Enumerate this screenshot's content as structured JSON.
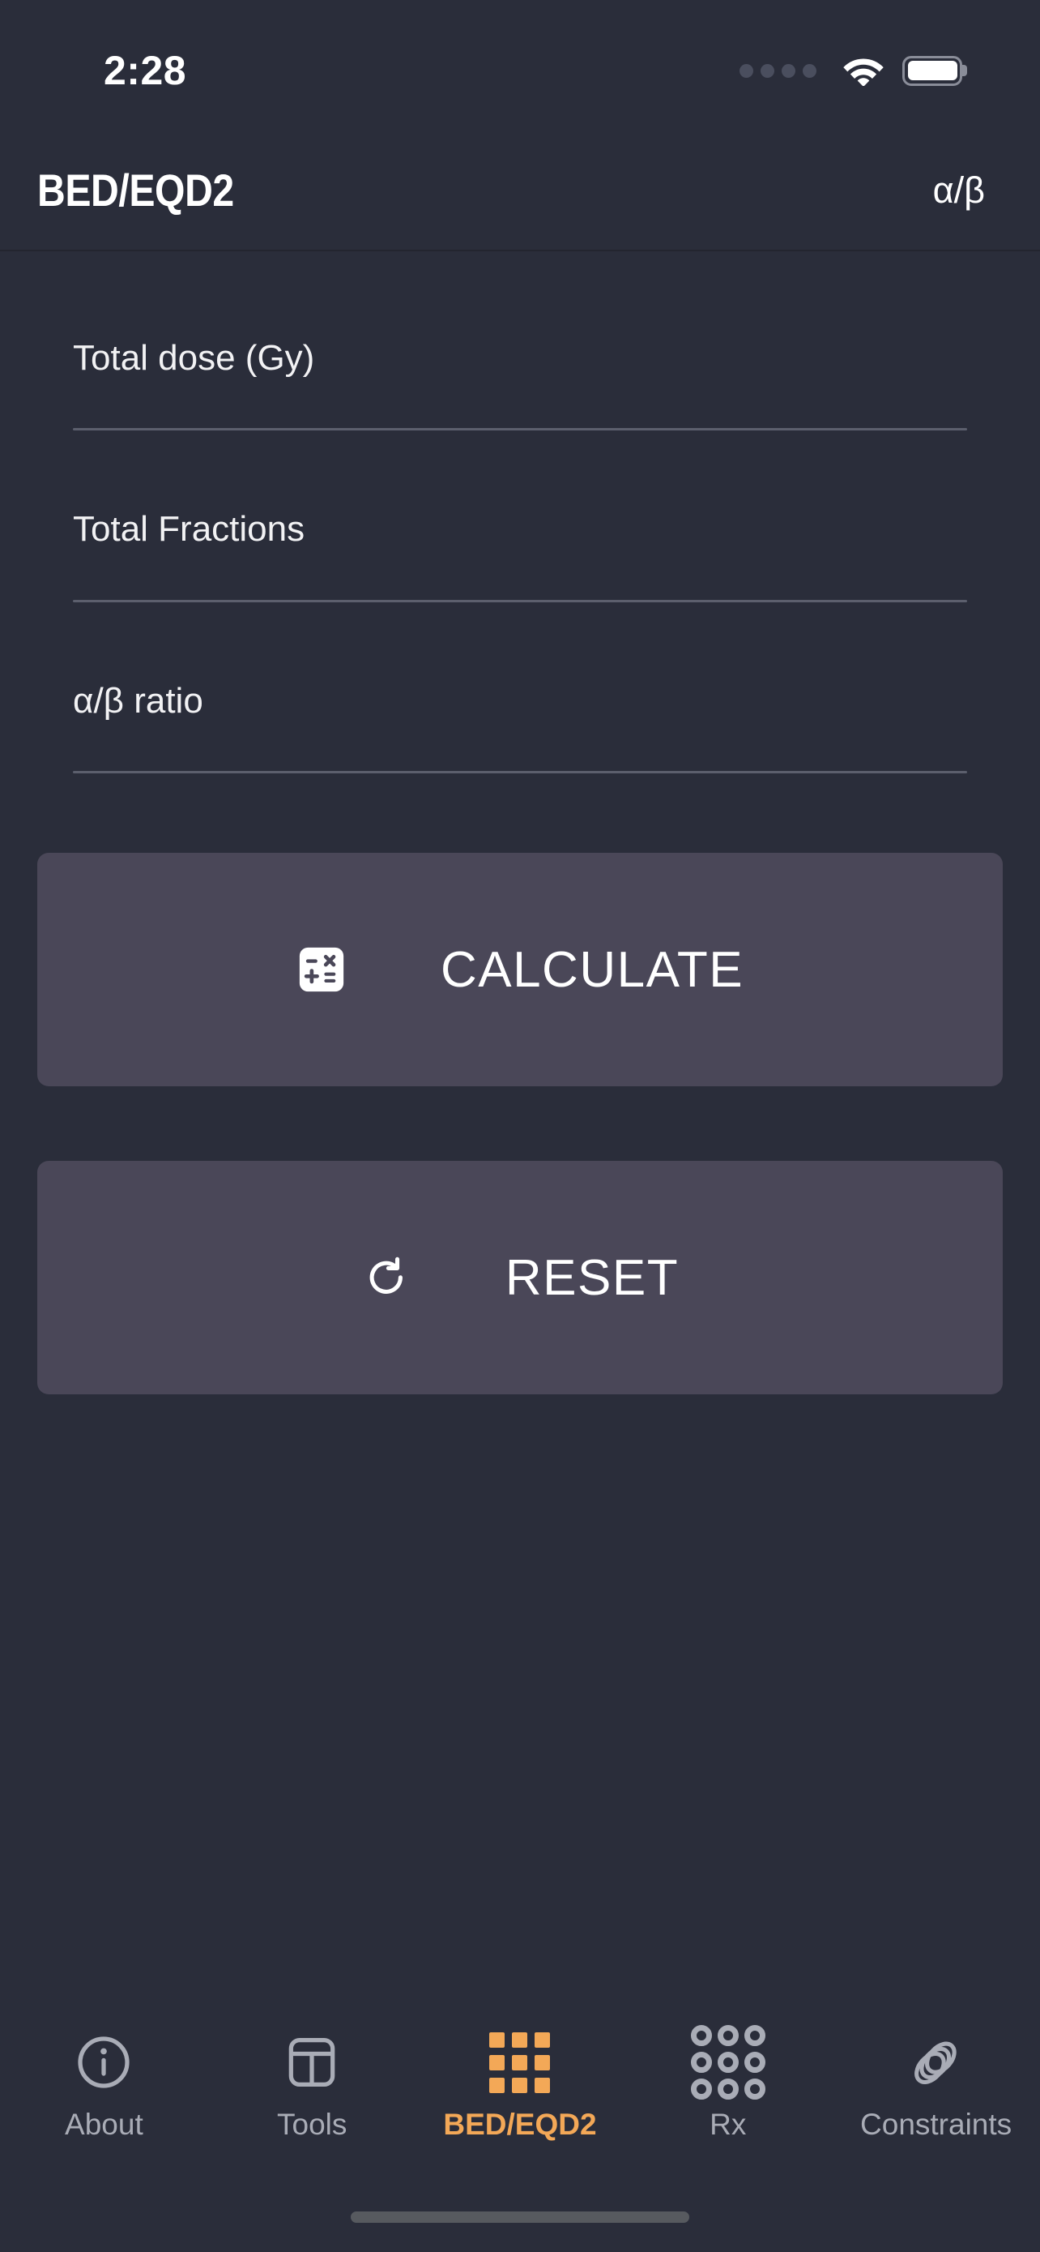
{
  "status_bar": {
    "time": "2:28",
    "cellular_icon": "cellular-dots-icon",
    "wifi_icon": "wifi-icon",
    "battery_icon": "battery-full-icon"
  },
  "header": {
    "title": "BED/EQD2",
    "action_label": "α/β",
    "action_icon": "alpha-beta-icon"
  },
  "form": {
    "fields": [
      {
        "label": "Total dose (Gy)",
        "value": "",
        "placeholder": ""
      },
      {
        "label": "Total Fractions",
        "value": "",
        "placeholder": ""
      },
      {
        "label": "α/β ratio",
        "value": "",
        "placeholder": ""
      }
    ]
  },
  "actions": {
    "calculate": {
      "label": "CALCULATE",
      "icon": "calculator-icon"
    },
    "reset": {
      "label": "RESET",
      "icon": "refresh-icon"
    }
  },
  "tabbar": {
    "items": [
      {
        "label": "About",
        "icon": "info-circle-icon",
        "active": false
      },
      {
        "label": "Tools",
        "icon": "layout-grid-icon",
        "active": false
      },
      {
        "label": "BED/EQD2",
        "icon": "grid-squares-icon",
        "active": true
      },
      {
        "label": "Rx",
        "icon": "grid-pills-icon",
        "active": false
      },
      {
        "label": "Constraints",
        "icon": "stacked-rings-icon",
        "active": false
      }
    ]
  },
  "colors": {
    "background": "#2a2d3a",
    "button": "#4a4758",
    "accent": "#f3a857",
    "text_primary": "#ffffff",
    "text_muted": "#a9acb6",
    "underline": "#5c5f6d"
  }
}
